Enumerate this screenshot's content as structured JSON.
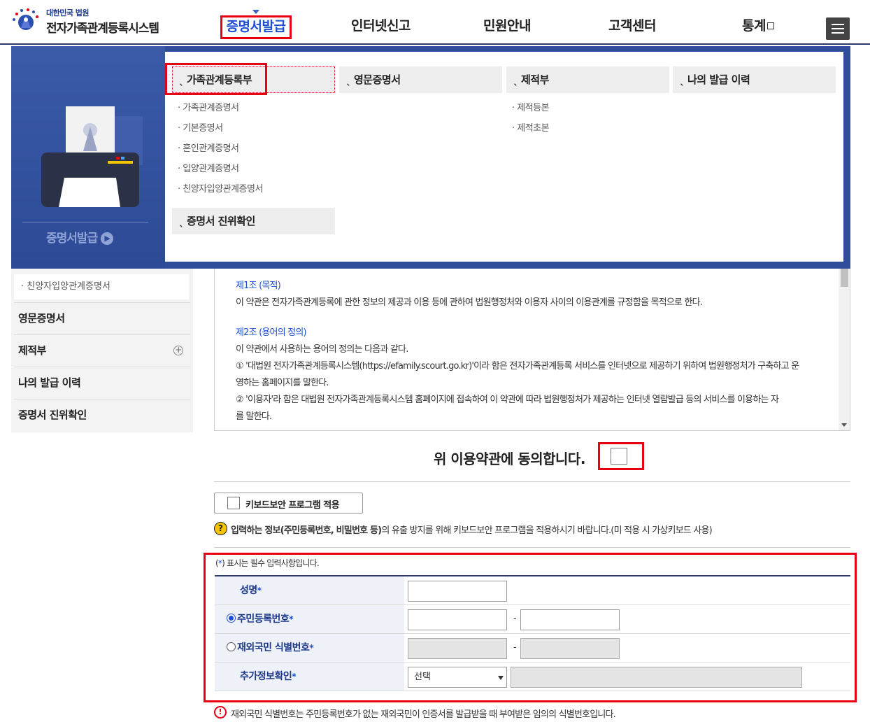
{
  "header": {
    "logo_sub": "대한민국 법원",
    "logo_title": "전자가족관계등록시스템",
    "nav": [
      "증명서발급",
      "인터넷신고",
      "민원안내",
      "고객센터",
      "통계"
    ],
    "menu_icon": "hamburger-icon"
  },
  "mega_menu": {
    "caption": "증명서발급",
    "columns": [
      {
        "title": "가족관계등록부",
        "items": [
          "가족관계증명서",
          "기본증명서",
          "혼인관계증명서",
          "입양관계증명서",
          "친양자입양관계증명서"
        ]
      },
      {
        "title": "영문증명서",
        "items": []
      },
      {
        "title": "제적부",
        "items": [
          "제적등본",
          "제적초본"
        ]
      },
      {
        "title": "나의 발급 이력",
        "items": []
      }
    ],
    "extra_title": "증명서 진위확인"
  },
  "sidebar": {
    "sub_item": "· 친양자입양관계증명서",
    "items": [
      "영문증명서",
      "제적부",
      "나의 발급 이력",
      "증명서 진위확인"
    ]
  },
  "terms": {
    "art1_title": "제1조 (목적)",
    "art1_body": "이 약관은 전자가족관계등록에 관한 정보의 제공과 이용 등에 관하여 법원행정처와 이용자 사이의 이용관계를 규정함을 목적으로 한다.",
    "art2_title": "제2조 (용어의 정의)",
    "art2_lines": [
      "이 약관에서 사용하는 용어의 정의는 다음과 같다.",
      "① '대법원 전자가족관계등록시스템(https://efamily.scourt.go.kr)'이라 함은 전자가족관계등록 서비스를 인터넷으로 제공하기 위하여 법원행정처가 구축하고 운",
      "영하는 홈페이지를 말한다.",
      "② '이용자'라 함은 대법원 전자가족관계등록시스템 홈페이지에 접속하여 이 약관에 따라 법원행정처가 제공하는 인터넷 열람발급 등의 서비스를 이용하는 자",
      "를 말한다."
    ]
  },
  "agreement": {
    "label": "위 이용약관에 동의합니다.",
    "checked": false
  },
  "keyboard": {
    "button_label": "키보드보안 프로그램 적용",
    "notice_bold": "입력하는 정보(주민등록번호, 비밀번호 등)",
    "notice_rest": "의 유출 방지를 위해 키보드보안 프로그램을 적용하시기 바랍니다.(미 적용 시 가상키보드 사용)"
  },
  "form": {
    "required_note_prefix": "(",
    "required_note_star": "*",
    "required_note_suffix": ") 표시는 필수 입력사항입니다.",
    "rows": [
      {
        "label": "성명",
        "star": "*"
      },
      {
        "label": "주민등록번호",
        "star": "*",
        "radio": true,
        "selected": true
      },
      {
        "label": "재외국민 식별번호",
        "star": "*",
        "radio": true,
        "selected": false
      },
      {
        "label": "추가정보확인",
        "star": "*"
      }
    ],
    "dash": "-",
    "select_value": "선택"
  },
  "footer_notice": "재외국민 식별번호는 주민등록번호가 없는 재외국민이 인증서를 발급받을 때 부여받은 임의의 식별번호입니다.",
  "colors": {
    "accent": "#e60012",
    "brand": "#2f4d9a",
    "link": "#1d4fd0"
  }
}
